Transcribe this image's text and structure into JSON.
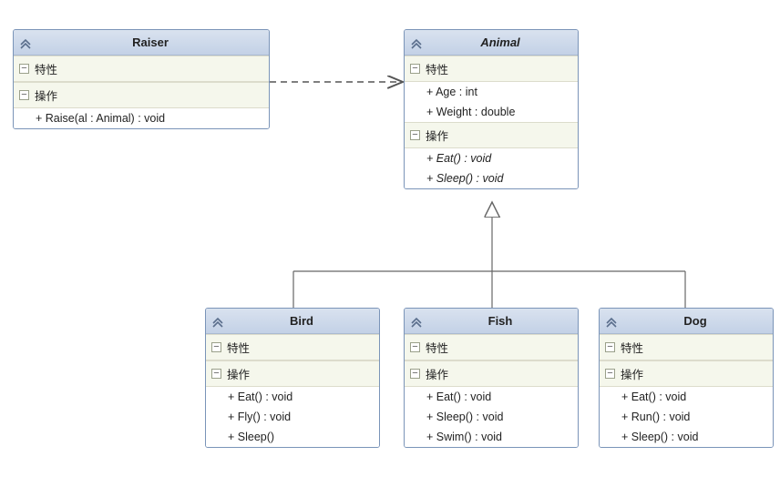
{
  "labels": {
    "attributes": "特性",
    "operations": "操作"
  },
  "classes": {
    "raiser": {
      "name": "Raiser",
      "abstract": false,
      "attributes": [],
      "operations": [
        {
          "sig": "+ Raise(al : Animal) : void",
          "abstract": false
        }
      ]
    },
    "animal": {
      "name": "Animal",
      "abstract": true,
      "attributes": [
        {
          "sig": "+ Age : int"
        },
        {
          "sig": "+ Weight : double"
        }
      ],
      "operations": [
        {
          "sig": "+ Eat() : void",
          "abstract": true
        },
        {
          "sig": "+ Sleep() : void",
          "abstract": true
        }
      ]
    },
    "bird": {
      "name": "Bird",
      "abstract": false,
      "attributes": [],
      "operations": [
        {
          "sig": "+ Eat() : void",
          "abstract": false
        },
        {
          "sig": "+ Fly() : void",
          "abstract": false
        },
        {
          "sig": "+ Sleep()",
          "abstract": false
        }
      ]
    },
    "fish": {
      "name": "Fish",
      "abstract": false,
      "attributes": [],
      "operations": [
        {
          "sig": "+ Eat() : void",
          "abstract": false
        },
        {
          "sig": "+ Sleep() : void",
          "abstract": false
        },
        {
          "sig": "+ Swim() : void",
          "abstract": false
        }
      ]
    },
    "dog": {
      "name": "Dog",
      "abstract": false,
      "attributes": [],
      "operations": [
        {
          "sig": "+ Eat() : void",
          "abstract": false
        },
        {
          "sig": "+ Run() : void",
          "abstract": false
        },
        {
          "sig": "+ Sleep() : void",
          "abstract": false
        }
      ]
    }
  },
  "relationships": [
    {
      "from": "raiser",
      "to": "animal",
      "type": "dependency"
    },
    {
      "from": "bird",
      "to": "animal",
      "type": "generalization"
    },
    {
      "from": "fish",
      "to": "animal",
      "type": "generalization"
    },
    {
      "from": "dog",
      "to": "animal",
      "type": "generalization"
    }
  ]
}
